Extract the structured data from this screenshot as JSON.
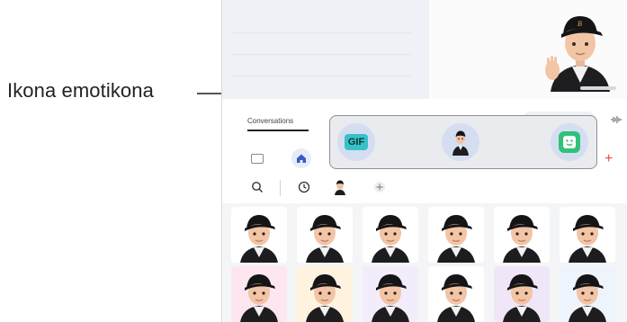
{
  "callout": {
    "label": "Ikona emotikona"
  },
  "screen": {
    "tab_label": "Conversations"
  },
  "popup": {
    "gif_label": "GIF"
  },
  "colors": {
    "accent_red": "#f04b4b",
    "gif_badge": "#35c2c8",
    "emoji_sticker": "#2fc27a",
    "popup_bg": "#e9ebee"
  },
  "icons": [
    "search-icon",
    "clock-icon",
    "avatar-tab-icon",
    "plus-icon",
    "home-icon",
    "keyboard-icon",
    "waveform-icon"
  ],
  "stickers": [
    "avatar-neutral",
    "avatar-smile",
    "avatar-wink",
    "avatar-wow",
    "avatar-shock",
    "avatar-wave",
    "avatar-ok",
    "avatar-sorry",
    "avatar-thanks",
    "avatar-question",
    "avatar-dizzy",
    "avatar-rain"
  ]
}
